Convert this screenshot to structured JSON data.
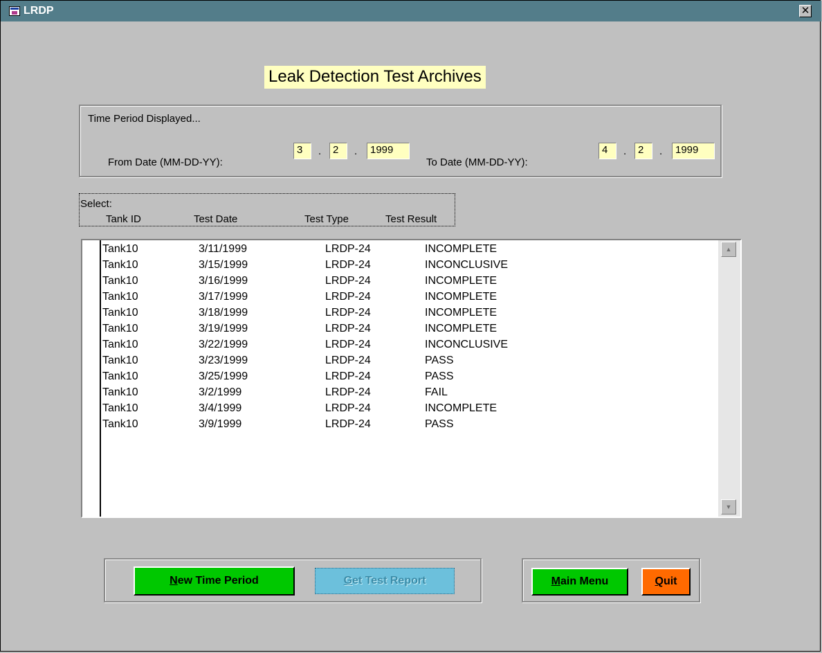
{
  "window": {
    "title": "LRDP",
    "close_glyph": "✕"
  },
  "page_title": "Leak Detection Test Archives",
  "period": {
    "heading": "Time Period Displayed...",
    "from_label": "From Date (MM-DD-YY):",
    "to_label": "To Date (MM-DD-YY):",
    "separator": ".",
    "from_month": "3",
    "from_day": "2",
    "from_year": "1999",
    "to_month": "4",
    "to_day": "2",
    "to_year": "1999"
  },
  "select": {
    "label": "Select:",
    "headers": [
      "Tank ID",
      "Test Date",
      "Test Type",
      "Test Result"
    ]
  },
  "rows": [
    [
      "Tank10",
      "3/11/1999",
      "LRDP-24",
      "INCOMPLETE"
    ],
    [
      "Tank10",
      "3/15/1999",
      "LRDP-24",
      "INCONCLUSIVE"
    ],
    [
      "Tank10",
      "3/16/1999",
      "LRDP-24",
      "INCOMPLETE"
    ],
    [
      "Tank10",
      "3/17/1999",
      "LRDP-24",
      "INCOMPLETE"
    ],
    [
      "Tank10",
      "3/18/1999",
      "LRDP-24",
      "INCOMPLETE"
    ],
    [
      "Tank10",
      "3/19/1999",
      "LRDP-24",
      "INCOMPLETE"
    ],
    [
      "Tank10",
      "3/22/1999",
      "LRDP-24",
      "INCONCLUSIVE"
    ],
    [
      "Tank10",
      "3/23/1999",
      "LRDP-24",
      "PASS"
    ],
    [
      "Tank10",
      "3/25/1999",
      "LRDP-24",
      "PASS"
    ],
    [
      "Tank10",
      "3/2/1999",
      "LRDP-24",
      "FAIL"
    ],
    [
      "Tank10",
      "3/4/1999",
      "LRDP-24",
      "INCOMPLETE"
    ],
    [
      "Tank10",
      "3/9/1999",
      "LRDP-24",
      "PASS"
    ]
  ],
  "scrollbar": {
    "up_glyph": "▲",
    "down_glyph": "▼"
  },
  "buttons": {
    "new_period_key": "N",
    "new_period_rest": "ew Time Period",
    "get_report_key": "G",
    "get_report_rest": "et Test Report",
    "main_menu_key": "M",
    "main_menu_rest": "ain Menu",
    "quit_key": "Q",
    "quit_rest": "uit"
  },
  "colors": {
    "title_bar": "#537d8a",
    "field_background": "#ffffc0",
    "green_button": "#00c800",
    "quit_button": "#ff6a00",
    "disabled_button": "#6cc0dc"
  }
}
